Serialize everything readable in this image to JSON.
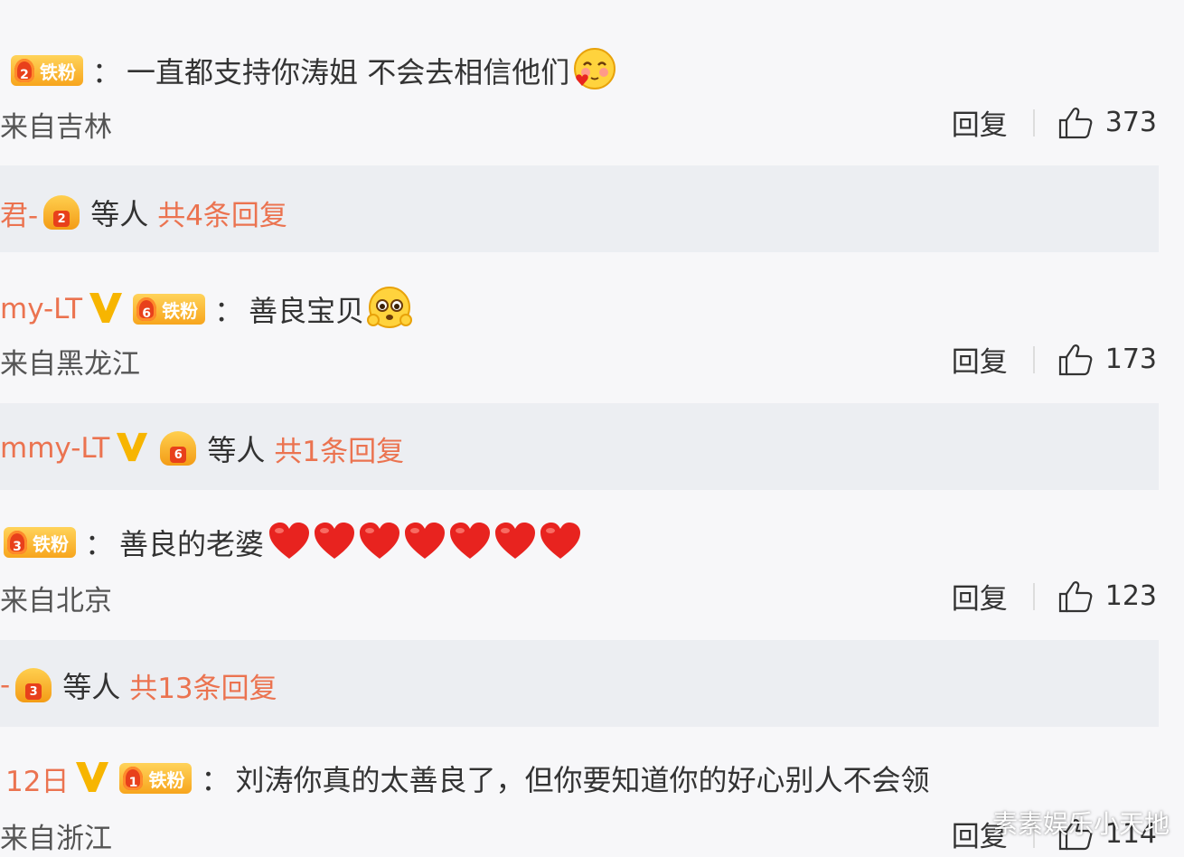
{
  "comments": [
    {
      "name": "",
      "fan_badge": {
        "level": "2",
        "label": "铁粉"
      },
      "colon": "：",
      "text": "一直都支持你涛姐 不会去相信他们",
      "location": "来自吉林",
      "reply_label": "回复",
      "likes": "373",
      "replies": {
        "name": "君-",
        "level": "2",
        "etc": "等人",
        "count_text": "共4条回复"
      }
    },
    {
      "name": "my-LT",
      "fan_badge": {
        "level": "6",
        "label": "铁粉"
      },
      "colon": "：",
      "text": "善良宝贝",
      "location": "来自黑龙江",
      "reply_label": "回复",
      "likes": "173",
      "replies": {
        "name": "mmy-LT",
        "level": "6",
        "etc": "等人",
        "count_text": "共1条回复"
      }
    },
    {
      "name": "",
      "fan_badge": {
        "level": "3",
        "label": "铁粉"
      },
      "colon": "：",
      "text": "善良的老婆",
      "location": "来自北京",
      "reply_label": "回复",
      "likes": "123",
      "replies": {
        "name": "-",
        "level": "3",
        "etc": "等人",
        "count_text": "共13条回复"
      }
    },
    {
      "name": "12日",
      "fan_badge": {
        "level": "1",
        "label": "铁粉"
      },
      "colon": "：",
      "text": "刘涛你真的太善良了，但你要知道你的好心别人不会领",
      "location": "来自浙江",
      "reply_label": "回复",
      "likes": "114"
    }
  ],
  "watermark": "素素娱乐小天地",
  "colors": {
    "accent": "#eb7350",
    "badge": "#f7a51d",
    "heart": "#e8231f",
    "background": "#f7f7f9",
    "reply_box": "#eceef2"
  },
  "icons": [
    "like-icon",
    "vip-v-icon",
    "blush-emoji-icon",
    "pleading-emoji-icon",
    "heart-icon"
  ]
}
